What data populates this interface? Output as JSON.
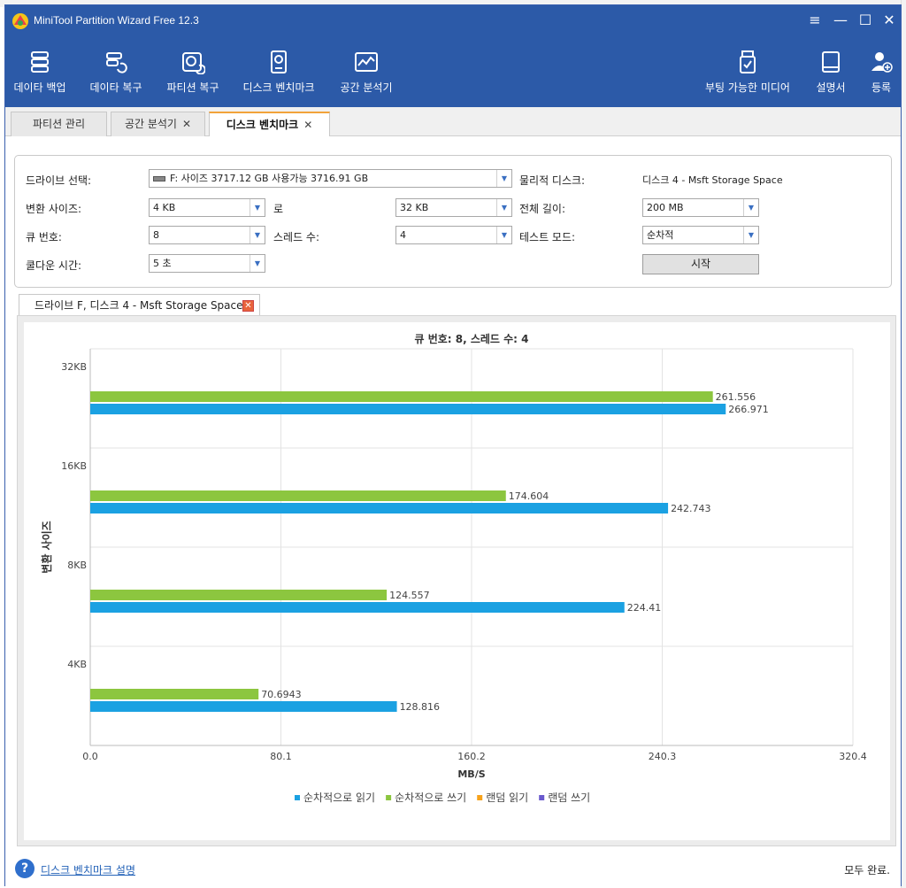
{
  "window": {
    "title": "MiniTool Partition Wizard Free 12.3"
  },
  "toolbar": {
    "left": [
      {
        "label": "데이타 백업",
        "icon": "backup-icon"
      },
      {
        "label": "데이타 복구",
        "icon": "data-recovery-icon"
      },
      {
        "label": "파티션 복구",
        "icon": "partition-recovery-icon"
      },
      {
        "label": "디스크 벤치마크",
        "icon": "disk-benchmark-icon"
      },
      {
        "label": "공간 분석기",
        "icon": "space-analyzer-icon"
      }
    ],
    "right": [
      {
        "label": "부팅 가능한 미디어",
        "icon": "bootable-media-icon"
      },
      {
        "label": "설명서",
        "icon": "manual-icon"
      },
      {
        "label": "등록",
        "icon": "register-icon"
      }
    ]
  },
  "tabs": [
    {
      "label": "파티션 관리",
      "closable": false
    },
    {
      "label": "공간 분석기",
      "closable": true
    },
    {
      "label": "디스크 벤치마크",
      "closable": true,
      "active": true
    }
  ],
  "settings": {
    "drive_label": "드라이브 선택:",
    "drive_value": "F:  사이즈 3717.12 GB  사용가능 3716.91 GB",
    "physical_label": "물리적 디스크:",
    "physical_value": "디스크 4 - Msft Storage Space",
    "transfer_label": "변환 사이즈:",
    "transfer_from": "4 KB",
    "to_label": "로",
    "transfer_to": "32 KB",
    "total_label": "전체 길이:",
    "total_value": "200 MB",
    "queue_label": "큐 번호:",
    "queue_value": "8",
    "threads_label": "스레드 수:",
    "threads_value": "4",
    "mode_label": "테스트 모드:",
    "mode_value": "순차적",
    "cooldown_label": "쿨다운 시간:",
    "cooldown_value": "5 초",
    "start_label": "시작"
  },
  "result_tab": {
    "label": "드라이브 F, 디스크 4 - Msft Storage Space"
  },
  "chart_data": {
    "type": "bar",
    "orientation": "horizontal",
    "title": "큐 번호: 8, 스레드 수: 4",
    "xlabel": "MB/S",
    "ylabel": "변환 사이즈",
    "categories": [
      "32KB",
      "16KB",
      "8KB",
      "4KB"
    ],
    "xlim": [
      0,
      320.4
    ],
    "xticks": [
      "0.0",
      "80.1",
      "160.2",
      "240.3",
      "320.4"
    ],
    "grid": true,
    "legend_position": "bottom",
    "series": [
      {
        "name": "순차적으로 쓰기",
        "color": "#8cc63f",
        "values": [
          261.556,
          174.604,
          124.557,
          70.6943
        ],
        "labels": [
          "261.556",
          "174.604",
          "124.557",
          "70.6943"
        ]
      },
      {
        "name": "순차적으로 읽기",
        "color": "#1ba1e2",
        "values": [
          266.971,
          242.743,
          224.41,
          128.816
        ],
        "labels": [
          "266.971",
          "242.743",
          "224.41",
          "128.816"
        ]
      }
    ],
    "legend": [
      {
        "name": "순차적으로 읽기",
        "color": "#1ba1e2"
      },
      {
        "name": "순차적으로 쓰기",
        "color": "#8cc63f"
      },
      {
        "name": "랜덤 읽기",
        "color": "#f7a21b"
      },
      {
        "name": "랜덤 쓰기",
        "color": "#6a5acd"
      }
    ]
  },
  "footer": {
    "help_link": "디스크 벤치마크 설명",
    "status": "모두 완료."
  }
}
